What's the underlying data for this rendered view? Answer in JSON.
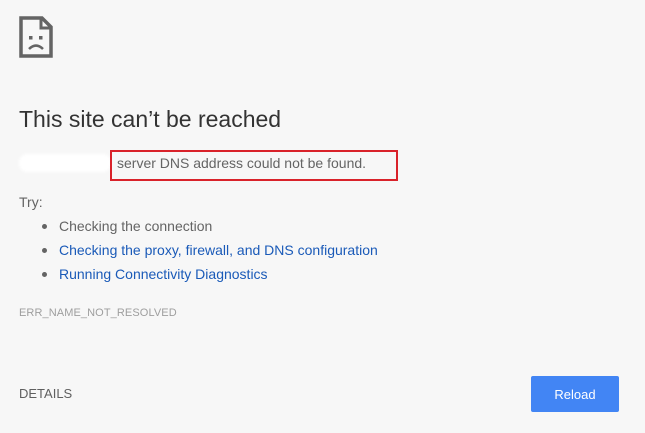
{
  "page": {
    "icon": "sad-page-icon",
    "title": "This site can’t be reached",
    "subtitle": "server DNS address could not be found.",
    "try_label": "Try:",
    "suggestions": [
      {
        "label": "Checking the connection",
        "is_link": false
      },
      {
        "label": "Checking the proxy, firewall, and DNS configuration",
        "is_link": true
      },
      {
        "label": "Running Connectivity Diagnostics",
        "is_link": true
      }
    ],
    "error_code": "ERR_NAME_NOT_RESOLVED",
    "details_label": "DETAILS",
    "reload_label": "Reload"
  },
  "colors": {
    "background": "#f7f7f7",
    "title": "#333333",
    "body_text": "#646464",
    "link": "#1a5ab8",
    "error_code": "#9e9e9e",
    "highlight_box": "#d9222a",
    "primary_button": "#4285f4"
  }
}
